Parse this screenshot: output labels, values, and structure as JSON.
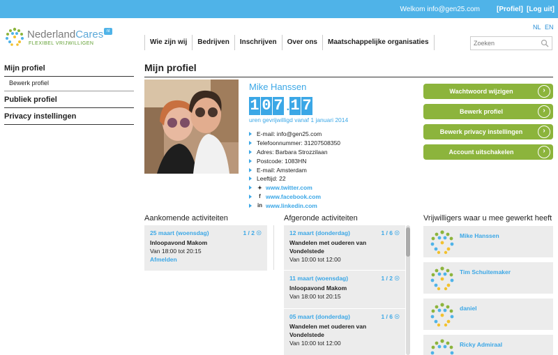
{
  "header": {
    "welcome": "Welkom info@gen25.com",
    "profile_link": "[Profiel]",
    "logout_link": "[Log uit]",
    "lang_nl": "NL",
    "lang_en": "EN",
    "accent": "#4fb3e8"
  },
  "logo": {
    "name_a": "Nederland",
    "name_b": "Cares",
    "tagline": "FLEXIBEL VRIJWILLIGEN",
    "badge": "nl"
  },
  "nav": {
    "items": [
      "Wie zijn wij",
      "Bedrijven",
      "Inschrijven",
      "Over ons",
      "Maatschappelijke organisaties"
    ]
  },
  "search": {
    "placeholder": "Zoeken"
  },
  "sidebar": {
    "my_profile": "Mijn profiel",
    "edit_profile": "Bewerk profiel",
    "public_profile": "Publiek profiel",
    "privacy": "Privacy instellingen"
  },
  "main": {
    "title": "Mijn profiel",
    "profile": {
      "name": "Mike Hanssen",
      "hours_digits": [
        "1",
        "0",
        "7",
        "1",
        "7"
      ],
      "hours_value": "107.17",
      "hours_caption": "uren gevrijwilligd vanaf 1 januari 2014",
      "details": [
        "E-mail: info@gen25.com",
        "Telefoonnummer: 31207508350",
        "Adres: Barbara Strozzilaan",
        "Postcode: 1083HN",
        "E-mail: Amsterdam",
        "Leeftijd: 22"
      ],
      "social": [
        {
          "icon": "twitter-icon",
          "glyph": "✦",
          "url": "www.twitter.com"
        },
        {
          "icon": "facebook-icon",
          "glyph": "f",
          "url": "www.facebook.com"
        },
        {
          "icon": "linkedin-icon",
          "glyph": "in",
          "url": "www.linkedin.com"
        }
      ]
    },
    "actions": [
      "Wachtwoord wijzigen",
      "Bewerk profiel",
      "Bewerk privacy instellingen",
      "Account uitschakelen"
    ],
    "action_color": "#8cb43c"
  },
  "upcoming": {
    "heading": "Aankomende activiteiten",
    "items": [
      {
        "date": "25 maart (woensdag)",
        "count": "1 / 2",
        "title": "Inloopavond Makom",
        "time": "Van 18:00 tot 20:15",
        "cancel": "Afmelden"
      }
    ]
  },
  "completed": {
    "heading": "Afgeronde activiteiten",
    "items": [
      {
        "date": "12 maart (donderdag)",
        "count": "1 / 6",
        "title_1": "Wandelen met ouderen van",
        "title_2": "Vondelstede",
        "time": "Van 10:00 tot 12:00"
      },
      {
        "date": "11 maart (woensdag)",
        "count": "1 / 2",
        "title_1": "Inloopavond Makom",
        "title_2": "",
        "time": "Van 18:00 tot 20:15"
      },
      {
        "date": "05 maart (donderdag)",
        "count": "1 / 6",
        "title_1": "Wandelen met ouderen van",
        "title_2": "Vondelstede",
        "time": "Van 10:00 tot 12:00"
      }
    ]
  },
  "volunteers": {
    "heading": "Vrijwilligers waar u mee gewerkt heeft",
    "items": [
      "Mike Hanssen",
      "Tim Schuitemaker",
      "daniel",
      "Ricky Admiraal"
    ]
  }
}
